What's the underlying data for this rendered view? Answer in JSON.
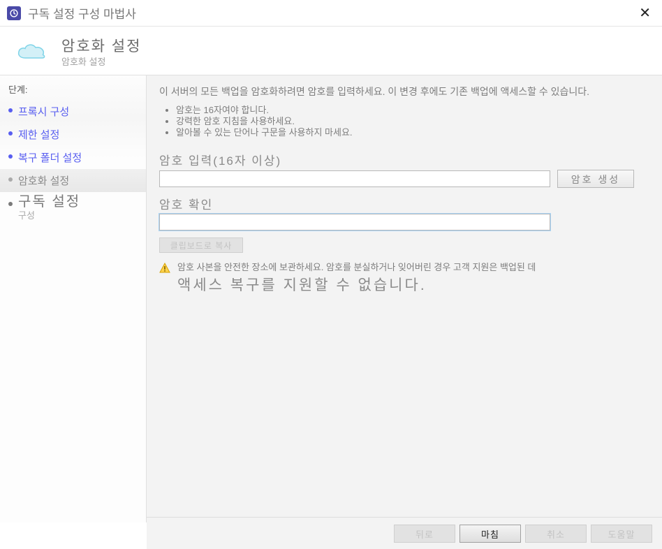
{
  "titlebar": {
    "title": "구독 설정 구성 마법사"
  },
  "header": {
    "title": "암호화 설정",
    "subtitle": "암호화 설정"
  },
  "sidebar": {
    "steps_label": "단계:",
    "items": [
      {
        "label": "프록시 구성"
      },
      {
        "label": "제한 설정"
      },
      {
        "label": "복구 폴더 설정"
      },
      {
        "label": "암호화 설정"
      },
      {
        "label": "구독 설정",
        "sub": "구성"
      }
    ]
  },
  "main": {
    "description": "이 서버의 모든 백업을 암호화하려면 암호를 입력하세요. 이 변경 후에도 기존 백업에 액세스할 수 있습니다.",
    "tips": [
      "암호는 16자여야 합니다.",
      "강력한 암호 지침을 사용하세요.",
      "알아볼 수 있는 단어나 구문을 사용하지 마세요."
    ],
    "enter_label": "암호 입력(16자 이상)",
    "confirm_label": "암호 확인",
    "generate_label": "암호 생성",
    "clipboard_label": "클립보드로 복사",
    "warning_text": "암호 사본을 안전한 장소에 보관하세요. 암호를 분실하거나 잊어버린 경우 고객 지원은 백업된 데",
    "warning_big": "액세스 복구를 지원할 수 없습니다."
  },
  "footer": {
    "back": "뒤로",
    "finish": "마침",
    "cancel": "취소",
    "help": "도움말"
  }
}
